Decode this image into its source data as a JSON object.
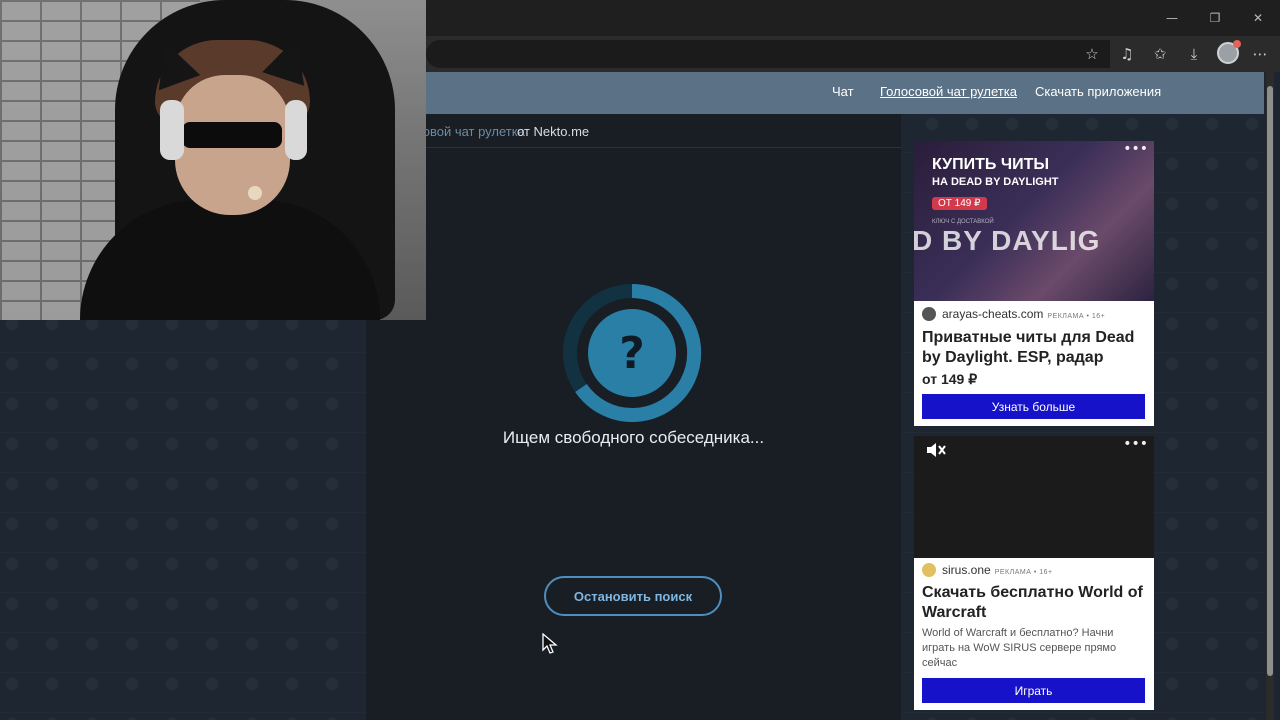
{
  "browser": {
    "window_controls": {
      "minimize": "—",
      "restore": "❐",
      "close": "✕"
    },
    "toolbar_icons": [
      "star-icon",
      "music-note-icon",
      "favorites-icon",
      "download-icon",
      "profile-avatar",
      "more-icon"
    ]
  },
  "site": {
    "nav": [
      {
        "label": "Чат",
        "active": false
      },
      {
        "label": "Голосовой чат рулетка",
        "active": true
      },
      {
        "label": "Скачать приложения",
        "active": false
      }
    ],
    "breadcrumb": {
      "link": "Голосовой чат рулетка",
      "suffix": "от Nekto.me"
    },
    "search": {
      "symbol": "?",
      "status": "Ищем свободного собеседника...",
      "stop_label": "Остановить поиск"
    }
  },
  "ads": [
    {
      "banner_title": "КУПИТЬ ЧИТЫ",
      "banner_subtitle": "НА DEAD BY DAYLIGHT",
      "banner_price": "ОТ 149 ₽",
      "banner_small": "КЛЮЧ С ДОСТАВКОЙ",
      "banner_big": "D BY DAYLIG",
      "source": "arayas-cheats.com",
      "label": "РЕКЛАМА • 16+",
      "title": "Приватные читы для Dead by Daylight. ESP, радар",
      "price": "от 149 ₽",
      "button": "Узнать больше",
      "more": "•••"
    },
    {
      "source": "sirus.one",
      "label": "РЕКЛАМА • 16+",
      "title": "Скачать бесплатно World of Warcraft",
      "description": "World of Warcraft и бесплатно? Начни играть на WoW SIRUS сервере прямо сейчас",
      "button": "Играть",
      "more": "•••"
    }
  ],
  "colors": {
    "site_header": "#5b7185",
    "accent_ring": "#2a7fa6",
    "ad_button": "#1612c9"
  }
}
